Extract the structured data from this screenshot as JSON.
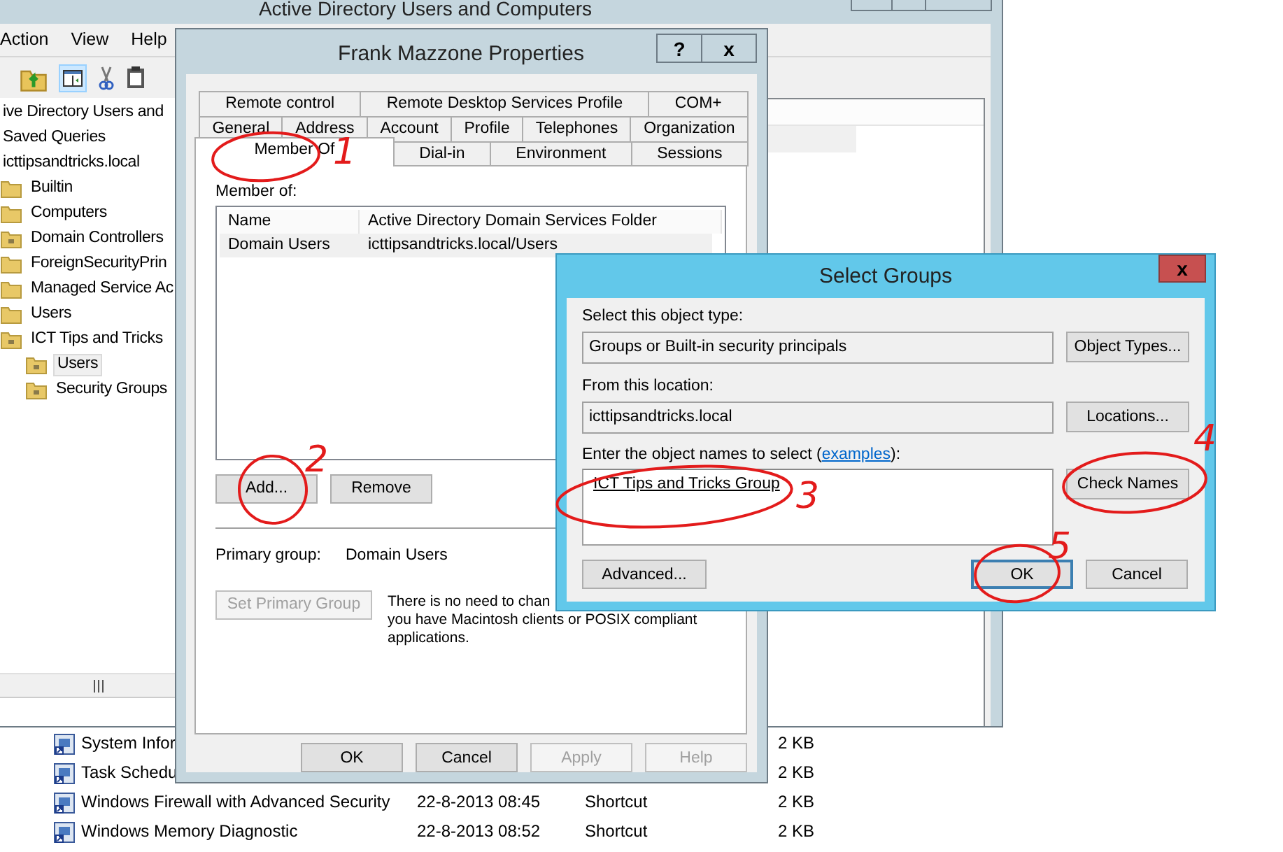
{
  "main_window": {
    "title": "Active Directory Users and Computers",
    "menu": [
      "Action",
      "View",
      "Help"
    ],
    "tree": [
      {
        "label": "ive Directory Users and",
        "selected": false,
        "children": [
          {
            "label": "Saved Queries",
            "selected": false
          },
          {
            "label": "icttipsandtricks.local",
            "selected": false,
            "children": [
              {
                "label": "Builtin",
                "kind": "folder",
                "selected": false
              },
              {
                "label": "Computers",
                "kind": "folder",
                "selected": false
              },
              {
                "label": "Domain Controllers",
                "kind": "ou",
                "selected": false
              },
              {
                "label": "ForeignSecurityPrin",
                "kind": "folder",
                "selected": false
              },
              {
                "label": "Managed Service Ac",
                "kind": "folder",
                "selected": false
              },
              {
                "label": "Users",
                "kind": "folder",
                "selected": false
              },
              {
                "label": "ICT Tips and Tricks",
                "kind": "ou",
                "selected": false,
                "children": [
                  {
                    "label": "Users",
                    "kind": "ou",
                    "selected": true
                  },
                  {
                    "label": "Security Groups",
                    "kind": "ou",
                    "selected": false
                  }
                ]
              }
            ]
          }
        ]
      }
    ]
  },
  "file_list": {
    "rows": [
      {
        "name": "System Infor",
        "size": "2 KB"
      },
      {
        "name": "Task Schedu",
        "size": "2 KB"
      },
      {
        "name": "Windows Firewall with Advanced Security",
        "date": "22-8-2013 08:45",
        "type": "Shortcut",
        "size": "2 KB"
      },
      {
        "name": "Windows Memory Diagnostic",
        "date": "22-8-2013 08:52",
        "type": "Shortcut",
        "size": "2 KB"
      }
    ]
  },
  "properties_dialog": {
    "title": "Frank Mazzone Properties",
    "help_button": "?",
    "close_button": "x",
    "tab_rows": [
      [
        {
          "label": "Remote control",
          "selected": false
        },
        {
          "label": "Remote Desktop Services Profile",
          "selected": false
        },
        {
          "label": "COM+",
          "selected": false
        }
      ],
      [
        {
          "label": "General",
          "selected": false
        },
        {
          "label": "Address",
          "selected": false
        },
        {
          "label": "Account",
          "selected": false
        },
        {
          "label": "Profile",
          "selected": false
        },
        {
          "label": "Telephones",
          "selected": false
        },
        {
          "label": "Organization",
          "selected": false
        }
      ],
      [
        {
          "label": "Member Of",
          "selected": true
        },
        {
          "label": "Dial-in",
          "selected": false
        },
        {
          "label": "Environment",
          "selected": false
        },
        {
          "label": "Sessions",
          "selected": false
        }
      ]
    ],
    "member_of_label": "Member of:",
    "groups_table": {
      "columns": [
        "Name",
        "Active Directory Domain Services Folder"
      ],
      "rows": [
        {
          "cells": [
            "Domain Users",
            "icttipsandtricks.local/Users"
          ],
          "selected": true
        }
      ]
    },
    "list_buttons": [
      {
        "label": "Add...",
        "disabled": false
      },
      {
        "label": "Remove",
        "disabled": false
      }
    ],
    "primary_group_label": "Primary group:",
    "primary_group_value": "Domain Users",
    "set_primary_button": {
      "label": "Set Primary Group",
      "disabled": true
    },
    "note_lines": [
      "There is no need to chan",
      "you have Macintosh clients or POSIX compliant",
      "applications."
    ],
    "footer_buttons": [
      {
        "label": "OK",
        "disabled": false
      },
      {
        "label": "Cancel",
        "disabled": false
      },
      {
        "label": "Apply",
        "disabled": true
      },
      {
        "label": "Help",
        "disabled": true
      }
    ]
  },
  "select_dialog": {
    "title": "Select Groups",
    "close_button": "x",
    "fields": [
      {
        "label": "Select this object type:",
        "value": "Groups or Built-in security principals",
        "button": "Object Types..."
      },
      {
        "label": "From this location:",
        "value": "icttipsandtricks.local",
        "button": "Locations..."
      }
    ],
    "names_label_before": "Enter the object names to select (",
    "names_link": "examples",
    "names_label_after": "):",
    "names_value": "ICT Tips and Tricks Group",
    "check_button": "Check Names",
    "footer_buttons": [
      {
        "label": "Advanced...",
        "default": false
      },
      {
        "label": "OK",
        "default": true
      },
      {
        "label": "Cancel",
        "default": false
      }
    ]
  },
  "annotations": [
    {
      "label": "1"
    },
    {
      "label": "2"
    },
    {
      "label": "3"
    },
    {
      "label": "4"
    },
    {
      "label": "5"
    }
  ]
}
